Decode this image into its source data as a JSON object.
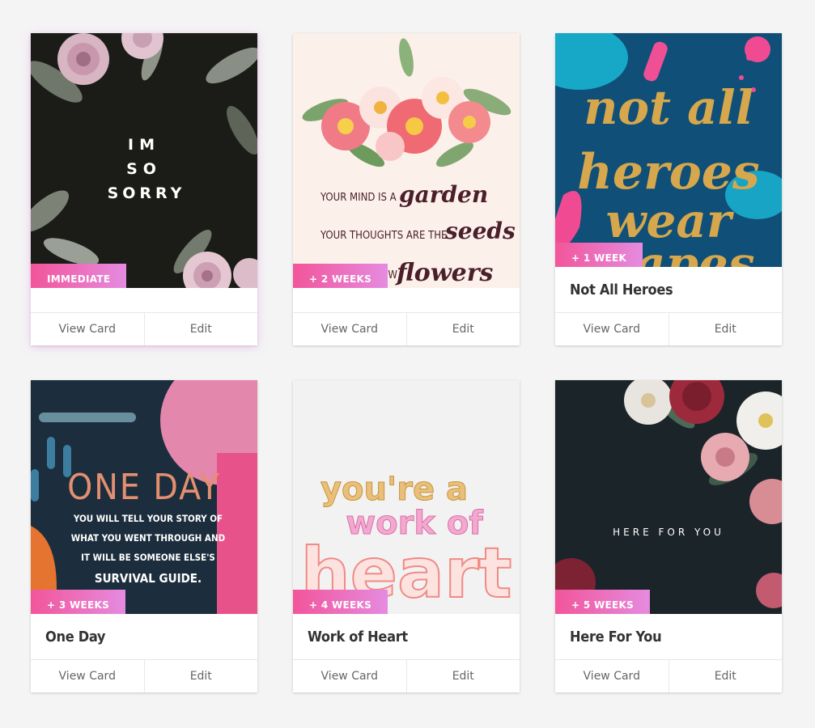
{
  "cards": [
    {
      "badge": "IMMEDIATE",
      "title": "",
      "view_label": "View Card",
      "edit_label": "Edit",
      "art": {
        "line1": "IM",
        "line2": "SO",
        "line3": "SORRY"
      }
    },
    {
      "badge": "+ 2 WEEKS",
      "title": "",
      "view_label": "View Card",
      "edit_label": "Edit",
      "art": {
        "line1a": "YOUR MIND IS A",
        "line1b": "garden",
        "line2a": "YOUR THOUGHTS ARE THE",
        "line2b": "seeds",
        "line3a": "ROW",
        "line3b": "flowers"
      }
    },
    {
      "badge": "+ 1 WEEK",
      "title": "Not All Heroes",
      "view_label": "View Card",
      "edit_label": "Edit",
      "art": {
        "line1": "not all",
        "line2": "heroes",
        "line3": "wear",
        "line4": "capes"
      }
    },
    {
      "badge": "+ 3 WEEKS",
      "title": "One Day",
      "view_label": "View Card",
      "edit_label": "Edit",
      "art": {
        "headline": "ONE DAY",
        "line1": "YOU WILL TELL YOUR STORY OF",
        "line2": "WHAT YOU WENT THROUGH AND",
        "line3": "IT WILL BE SOMEONE ELSE'S",
        "line4": "SURVIVAL GUIDE."
      }
    },
    {
      "badge": "+ 4 WEEKS",
      "title": "Work of Heart",
      "view_label": "View Card",
      "edit_label": "Edit",
      "art": {
        "line1": "you're a",
        "line2": "work of",
        "line3": "heart"
      }
    },
    {
      "badge": "+ 5 WEEKS",
      "title": "Here For You",
      "view_label": "View Card",
      "edit_label": "Edit",
      "art": {
        "line1": "HERE FOR YOU"
      }
    }
  ]
}
